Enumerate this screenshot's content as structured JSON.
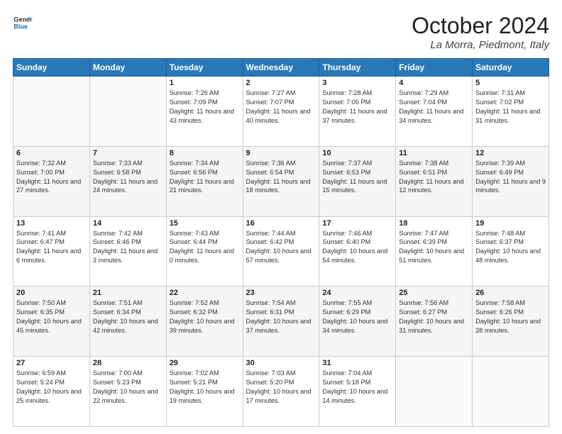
{
  "logo": {
    "line1": "General",
    "line2": "Blue"
  },
  "title": "October 2024",
  "location": "La Morra, Piedmont, Italy",
  "days_of_week": [
    "Sunday",
    "Monday",
    "Tuesday",
    "Wednesday",
    "Thursday",
    "Friday",
    "Saturday"
  ],
  "weeks": [
    [
      {
        "day": "",
        "info": ""
      },
      {
        "day": "",
        "info": ""
      },
      {
        "day": "1",
        "info": "Sunrise: 7:26 AM\nSunset: 7:09 PM\nDaylight: 11 hours and 43 minutes."
      },
      {
        "day": "2",
        "info": "Sunrise: 7:27 AM\nSunset: 7:07 PM\nDaylight: 11 hours and 40 minutes."
      },
      {
        "day": "3",
        "info": "Sunrise: 7:28 AM\nSunset: 7:05 PM\nDaylight: 11 hours and 37 minutes."
      },
      {
        "day": "4",
        "info": "Sunrise: 7:29 AM\nSunset: 7:04 PM\nDaylight: 11 hours and 34 minutes."
      },
      {
        "day": "5",
        "info": "Sunrise: 7:31 AM\nSunset: 7:02 PM\nDaylight: 11 hours and 31 minutes."
      }
    ],
    [
      {
        "day": "6",
        "info": "Sunrise: 7:32 AM\nSunset: 7:00 PM\nDaylight: 11 hours and 27 minutes."
      },
      {
        "day": "7",
        "info": "Sunrise: 7:33 AM\nSunset: 6:58 PM\nDaylight: 11 hours and 24 minutes."
      },
      {
        "day": "8",
        "info": "Sunrise: 7:34 AM\nSunset: 6:56 PM\nDaylight: 11 hours and 21 minutes."
      },
      {
        "day": "9",
        "info": "Sunrise: 7:36 AM\nSunset: 6:54 PM\nDaylight: 11 hours and 18 minutes."
      },
      {
        "day": "10",
        "info": "Sunrise: 7:37 AM\nSunset: 6:53 PM\nDaylight: 11 hours and 15 minutes."
      },
      {
        "day": "11",
        "info": "Sunrise: 7:38 AM\nSunset: 6:51 PM\nDaylight: 11 hours and 12 minutes."
      },
      {
        "day": "12",
        "info": "Sunrise: 7:39 AM\nSunset: 6:49 PM\nDaylight: 11 hours and 9 minutes."
      }
    ],
    [
      {
        "day": "13",
        "info": "Sunrise: 7:41 AM\nSunset: 6:47 PM\nDaylight: 11 hours and 6 minutes."
      },
      {
        "day": "14",
        "info": "Sunrise: 7:42 AM\nSunset: 6:46 PM\nDaylight: 11 hours and 3 minutes."
      },
      {
        "day": "15",
        "info": "Sunrise: 7:43 AM\nSunset: 6:44 PM\nDaylight: 11 hours and 0 minutes."
      },
      {
        "day": "16",
        "info": "Sunrise: 7:44 AM\nSunset: 6:42 PM\nDaylight: 10 hours and 57 minutes."
      },
      {
        "day": "17",
        "info": "Sunrise: 7:46 AM\nSunset: 6:40 PM\nDaylight: 10 hours and 54 minutes."
      },
      {
        "day": "18",
        "info": "Sunrise: 7:47 AM\nSunset: 6:39 PM\nDaylight: 10 hours and 51 minutes."
      },
      {
        "day": "19",
        "info": "Sunrise: 7:48 AM\nSunset: 6:37 PM\nDaylight: 10 hours and 48 minutes."
      }
    ],
    [
      {
        "day": "20",
        "info": "Sunrise: 7:50 AM\nSunset: 6:35 PM\nDaylight: 10 hours and 45 minutes."
      },
      {
        "day": "21",
        "info": "Sunrise: 7:51 AM\nSunset: 6:34 PM\nDaylight: 10 hours and 42 minutes."
      },
      {
        "day": "22",
        "info": "Sunrise: 7:52 AM\nSunset: 6:32 PM\nDaylight: 10 hours and 39 minutes."
      },
      {
        "day": "23",
        "info": "Sunrise: 7:54 AM\nSunset: 6:31 PM\nDaylight: 10 hours and 37 minutes."
      },
      {
        "day": "24",
        "info": "Sunrise: 7:55 AM\nSunset: 6:29 PM\nDaylight: 10 hours and 34 minutes."
      },
      {
        "day": "25",
        "info": "Sunrise: 7:56 AM\nSunset: 6:27 PM\nDaylight: 10 hours and 31 minutes."
      },
      {
        "day": "26",
        "info": "Sunrise: 7:58 AM\nSunset: 6:26 PM\nDaylight: 10 hours and 28 minutes."
      }
    ],
    [
      {
        "day": "27",
        "info": "Sunrise: 6:59 AM\nSunset: 5:24 PM\nDaylight: 10 hours and 25 minutes."
      },
      {
        "day": "28",
        "info": "Sunrise: 7:00 AM\nSunset: 5:23 PM\nDaylight: 10 hours and 22 minutes."
      },
      {
        "day": "29",
        "info": "Sunrise: 7:02 AM\nSunset: 5:21 PM\nDaylight: 10 hours and 19 minutes."
      },
      {
        "day": "30",
        "info": "Sunrise: 7:03 AM\nSunset: 5:20 PM\nDaylight: 10 hours and 17 minutes."
      },
      {
        "day": "31",
        "info": "Sunrise: 7:04 AM\nSunset: 5:18 PM\nDaylight: 10 hours and 14 minutes."
      },
      {
        "day": "",
        "info": ""
      },
      {
        "day": "",
        "info": ""
      }
    ]
  ]
}
